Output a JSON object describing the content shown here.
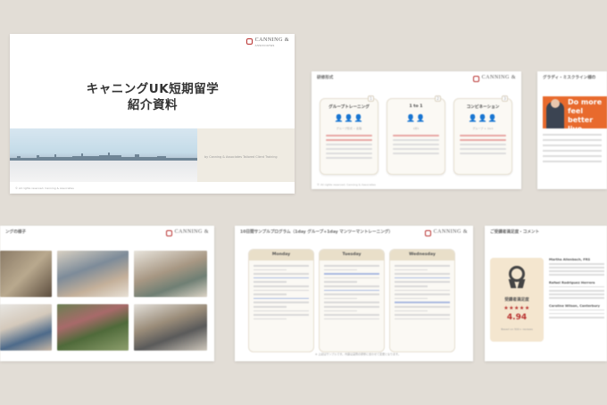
{
  "logo": {
    "name": "CANNING &",
    "sub": "ASSOCIATES"
  },
  "slide1": {
    "title_line1": "キャニングUK短期留学",
    "title_line2": "紹介資料",
    "subtitle": "by Canning & Associates Tailored Client Training",
    "footer": "© All rights reserved. Canning & Associates"
  },
  "slide2": {
    "header": "研修形式",
    "cards": [
      {
        "num": "1",
        "title": "グループトレーニング",
        "people": "👤👤👤",
        "caption": "グループ形式 ~ 名程"
      },
      {
        "num": "2",
        "title": "1 to 1",
        "people": "👤👤",
        "caption": "1対1"
      },
      {
        "num": "3",
        "title": "コンビネーション",
        "people": "👤👤👤",
        "caption": "グループ + 1to1"
      }
    ]
  },
  "slide3": {
    "header": "グラディ・ミスクライン様の",
    "banner_text": "Do more feel better live longer"
  },
  "slide4": {
    "header": "ングの様子"
  },
  "slide5": {
    "header": "10日間サンプルプログラム（1day グループ+1day マンツーマントレーニング）",
    "days": [
      "Monday",
      "Tuesday",
      "Wednesday"
    ],
    "bottom": "※ 上記はサンプルです。内容は実際の研修に合わせて変更となります。"
  },
  "slide6": {
    "header": "ご受講者満足度・コメント",
    "award_label": "受講者満足度",
    "stars": "★★★★★",
    "score": "4.94",
    "award_caption": "Based on 500+ reviews",
    "reviewers": [
      "Martha Allenbach, FRS",
      "Rafael Rodriguez Herrera",
      "Caroline Wilson, Canterbury"
    ]
  }
}
